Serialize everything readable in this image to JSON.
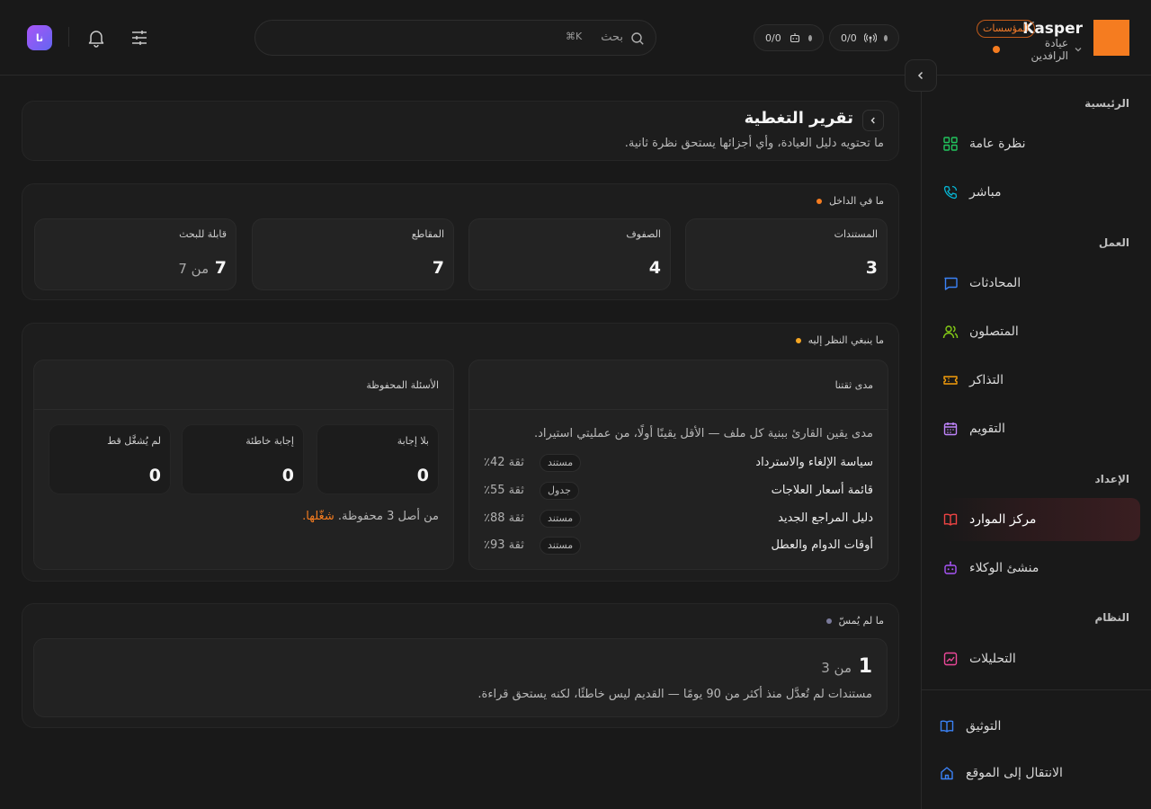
{
  "brand": {
    "name": "Kasper",
    "badge": "المؤسسات",
    "clinic": "عيادة الرافدين"
  },
  "status_pills": [
    {
      "value": "0/0",
      "icon": "broadcast-icon"
    },
    {
      "value": "0/0",
      "icon": "bot-icon"
    }
  ],
  "search": {
    "placeholder": "بحث",
    "shortcut": "⌘K"
  },
  "user": {
    "initials": "نا"
  },
  "sidebar": {
    "sections": [
      {
        "label": "الرئيسية",
        "items": [
          {
            "label": "نظرة عامة",
            "icon": "grid-icon",
            "color": "#22c55e"
          },
          {
            "label": "مباشر",
            "icon": "phone-icon",
            "color": "#06b6d4"
          }
        ]
      },
      {
        "label": "العمل",
        "items": [
          {
            "label": "المحادثات",
            "icon": "chat-icon",
            "color": "#3b82f6"
          },
          {
            "label": "المتصلون",
            "icon": "users-icon",
            "color": "#84cc16"
          },
          {
            "label": "التذاكر",
            "icon": "ticket-icon",
            "color": "#f59e0b"
          },
          {
            "label": "التقويم",
            "icon": "calendar-icon",
            "color": "#c084fc"
          }
        ]
      },
      {
        "label": "الإعداد",
        "items": [
          {
            "label": "مركز الموارد",
            "icon": "book-icon",
            "color": "#ef4444",
            "active": true
          },
          {
            "label": "منشئ الوكلاء",
            "icon": "bot-icon",
            "color": "#a855f7"
          }
        ]
      },
      {
        "label": "النظام",
        "items": [
          {
            "label": "التحليلات",
            "icon": "chart-icon",
            "color": "#ec4899"
          }
        ]
      }
    ],
    "footer": [
      {
        "label": "التوثيق",
        "icon": "book-icon",
        "color": "#3b82f6"
      },
      {
        "label": "الانتقال إلى الموقع",
        "icon": "home-icon",
        "color": "#3b82f6"
      }
    ]
  },
  "page": {
    "title": "تقرير التغطية",
    "subtitle": "ما تحتويه دليل العيادة، وأي أجزائها يستحق نظرة ثانية."
  },
  "inside": {
    "title": "ما في الداخل",
    "dot_color": "#f57c20",
    "stats": [
      {
        "label": "المستندات",
        "value": "3"
      },
      {
        "label": "الصفوف",
        "value": "4"
      },
      {
        "label": "المقاطع",
        "value": "7"
      },
      {
        "label": "قابلة للبحث",
        "value": "7",
        "of": "من 7"
      }
    ]
  },
  "attention": {
    "title": "ما ينبغي النظر إليه",
    "dot_color": "#f5a623",
    "confidence": {
      "title": "مدى ثقتنا",
      "description": "مدى يقين القارئ ببنية كل ملف — الأقل يقينًا أولًا، من عمليتي استيراد.",
      "rows": [
        {
          "name": "سياسة الإلغاء والاسترداد",
          "tag": "مستند",
          "confidence": "ثقة 42٪"
        },
        {
          "name": "قائمة أسعار العلاجات",
          "tag": "جدول",
          "confidence": "ثقة 55٪"
        },
        {
          "name": "دليل المراجع الجديد",
          "tag": "مستند",
          "confidence": "ثقة 88٪"
        },
        {
          "name": "أوقات الدوام والعطل",
          "tag": "مستند",
          "confidence": "ثقة 93٪"
        }
      ]
    },
    "saved": {
      "title": "الأسئلة المحفوظة",
      "stats": [
        {
          "label": "بلا إجابة",
          "value": "0"
        },
        {
          "label": "إجابة خاطئة",
          "value": "0"
        },
        {
          "label": "لم يُشغَّل قط",
          "value": "0"
        }
      ],
      "footer_text": "من أصل 3 محفوظة.",
      "footer_link": "شغّلها."
    }
  },
  "untouched": {
    "title": "ما لم يُمسّ",
    "dot_color": "#7a7a9a",
    "value": "1",
    "of": "من 3",
    "description": "مستندات لم تُعدَّل منذ أكثر من 90 يومًا — القديم ليس خاطئًا، لكنه يستحق قراءة."
  }
}
